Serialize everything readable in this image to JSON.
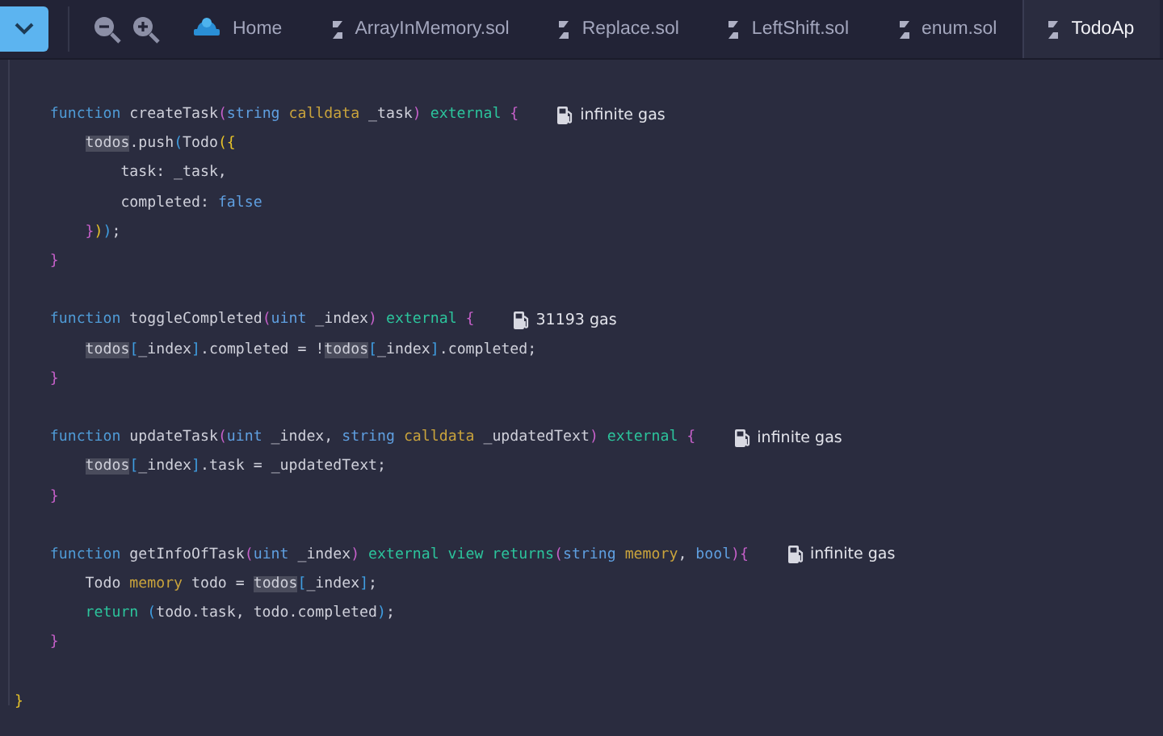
{
  "tabbar": {
    "tabs": [
      {
        "kind": "home",
        "label": "Home",
        "selected": false
      },
      {
        "kind": "file",
        "label": "ArrayInMemory.sol",
        "selected": false
      },
      {
        "kind": "file",
        "label": "Replace.sol",
        "selected": false
      },
      {
        "kind": "file",
        "label": "LeftShift.sol",
        "selected": false
      },
      {
        "kind": "file",
        "label": "enum.sol",
        "selected": false
      },
      {
        "kind": "file",
        "label": "TodoAp",
        "selected": true
      }
    ]
  },
  "editor": {
    "lines": [
      {
        "kind": "code",
        "tokens": [
          {
            "kind": "kw",
            "t": "    function"
          },
          {
            "kind": "id",
            "t": " createTask"
          },
          {
            "kind": "p1",
            "t": "("
          },
          {
            "kind": "type",
            "t": "string"
          },
          {
            "kind": "loc",
            "t": " calldata"
          },
          {
            "kind": "id",
            "t": " _task"
          },
          {
            "kind": "p1",
            "t": ")"
          },
          {
            "kind": "mod",
            "t": " external"
          },
          {
            "kind": "p1",
            "t": " {"
          }
        ],
        "gas": "infinite gas"
      },
      {
        "kind": "code",
        "tokens": [
          {
            "kind": "ref",
            "t": "        todos"
          },
          {
            "kind": "id",
            "t": ".push"
          },
          {
            "kind": "p3",
            "t": "("
          },
          {
            "kind": "id",
            "t": "Todo"
          },
          {
            "kind": "p2",
            "t": "({"
          }
        ]
      },
      {
        "kind": "code",
        "tokens": [
          {
            "kind": "id",
            "t": "            task: _task,"
          }
        ]
      },
      {
        "kind": "code",
        "tokens": [
          {
            "kind": "id",
            "t": "            completed: "
          },
          {
            "kind": "lit",
            "t": "false"
          }
        ]
      },
      {
        "kind": "code",
        "tokens": [
          {
            "kind": "p1",
            "t": "        }"
          },
          {
            "kind": "p2",
            "t": ")"
          },
          {
            "kind": "p3",
            "t": ")"
          },
          {
            "kind": "id",
            "t": ";"
          }
        ]
      },
      {
        "kind": "code",
        "tokens": [
          {
            "kind": "p1",
            "t": "    }"
          }
        ]
      },
      {
        "kind": "blank"
      },
      {
        "kind": "code",
        "tokens": [
          {
            "kind": "kw",
            "t": "    function"
          },
          {
            "kind": "id",
            "t": " toggleCompleted"
          },
          {
            "kind": "p1",
            "t": "("
          },
          {
            "kind": "type",
            "t": "uint"
          },
          {
            "kind": "id",
            "t": " _index"
          },
          {
            "kind": "p1",
            "t": ")"
          },
          {
            "kind": "mod",
            "t": " external"
          },
          {
            "kind": "p1",
            "t": " {"
          }
        ],
        "gas": "31193 gas"
      },
      {
        "kind": "code",
        "tokens": [
          {
            "kind": "ref",
            "t": "        todos"
          },
          {
            "kind": "p3",
            "t": "["
          },
          {
            "kind": "id",
            "t": "_index"
          },
          {
            "kind": "p3",
            "t": "]"
          },
          {
            "kind": "id",
            "t": ".completed = !"
          },
          {
            "kind": "ref",
            "t": "todos"
          },
          {
            "kind": "p3",
            "t": "["
          },
          {
            "kind": "id",
            "t": "_index"
          },
          {
            "kind": "p3",
            "t": "]"
          },
          {
            "kind": "id",
            "t": ".completed;"
          }
        ]
      },
      {
        "kind": "code",
        "tokens": [
          {
            "kind": "p1",
            "t": "    }"
          }
        ]
      },
      {
        "kind": "blank"
      },
      {
        "kind": "code",
        "tokens": [
          {
            "kind": "kw",
            "t": "    function"
          },
          {
            "kind": "id",
            "t": " updateTask"
          },
          {
            "kind": "p1",
            "t": "("
          },
          {
            "kind": "type",
            "t": "uint"
          },
          {
            "kind": "id",
            "t": " _index,"
          },
          {
            "kind": "type",
            "t": " string"
          },
          {
            "kind": "loc",
            "t": " calldata"
          },
          {
            "kind": "id",
            "t": " _updatedText"
          },
          {
            "kind": "p1",
            "t": ")"
          },
          {
            "kind": "mod",
            "t": " external"
          },
          {
            "kind": "p1",
            "t": " {"
          }
        ],
        "gas": "infinite gas"
      },
      {
        "kind": "code",
        "tokens": [
          {
            "kind": "ref",
            "t": "        todos"
          },
          {
            "kind": "p3",
            "t": "["
          },
          {
            "kind": "id",
            "t": "_index"
          },
          {
            "kind": "p3",
            "t": "]"
          },
          {
            "kind": "id",
            "t": ".task = _updatedText;"
          }
        ]
      },
      {
        "kind": "code",
        "tokens": [
          {
            "kind": "p1",
            "t": "    }"
          }
        ]
      },
      {
        "kind": "blank"
      },
      {
        "kind": "code",
        "tokens": [
          {
            "kind": "kw",
            "t": "    function"
          },
          {
            "kind": "id",
            "t": " getInfoOfTask"
          },
          {
            "kind": "p1",
            "t": "("
          },
          {
            "kind": "type",
            "t": "uint"
          },
          {
            "kind": "id",
            "t": " _index"
          },
          {
            "kind": "p1",
            "t": ")"
          },
          {
            "kind": "mod",
            "t": " external view returns"
          },
          {
            "kind": "p1",
            "t": "("
          },
          {
            "kind": "type",
            "t": "string"
          },
          {
            "kind": "loc",
            "t": " memory"
          },
          {
            "kind": "id",
            "t": ","
          },
          {
            "kind": "type",
            "t": " bool"
          },
          {
            "kind": "p1",
            "t": "){"
          }
        ],
        "gas": "infinite gas"
      },
      {
        "kind": "code",
        "tokens": [
          {
            "kind": "id",
            "t": "        Todo"
          },
          {
            "kind": "loc",
            "t": " memory"
          },
          {
            "kind": "id",
            "t": " todo = "
          },
          {
            "kind": "ref",
            "t": "todos"
          },
          {
            "kind": "p3",
            "t": "["
          },
          {
            "kind": "id",
            "t": "_index"
          },
          {
            "kind": "p3",
            "t": "]"
          },
          {
            "kind": "id",
            "t": ";"
          }
        ]
      },
      {
        "kind": "code",
        "tokens": [
          {
            "kind": "mod",
            "t": "        return"
          },
          {
            "kind": "p3",
            "t": " ("
          },
          {
            "kind": "id",
            "t": "todo.task, todo.completed"
          },
          {
            "kind": "p3",
            "t": ")"
          },
          {
            "kind": "id",
            "t": ";"
          }
        ]
      },
      {
        "kind": "code",
        "tokens": [
          {
            "kind": "p1",
            "t": "    }"
          }
        ]
      },
      {
        "kind": "blank"
      },
      {
        "kind": "code",
        "tokens": [
          {
            "kind": "p2",
            "t": "}"
          }
        ]
      }
    ]
  }
}
